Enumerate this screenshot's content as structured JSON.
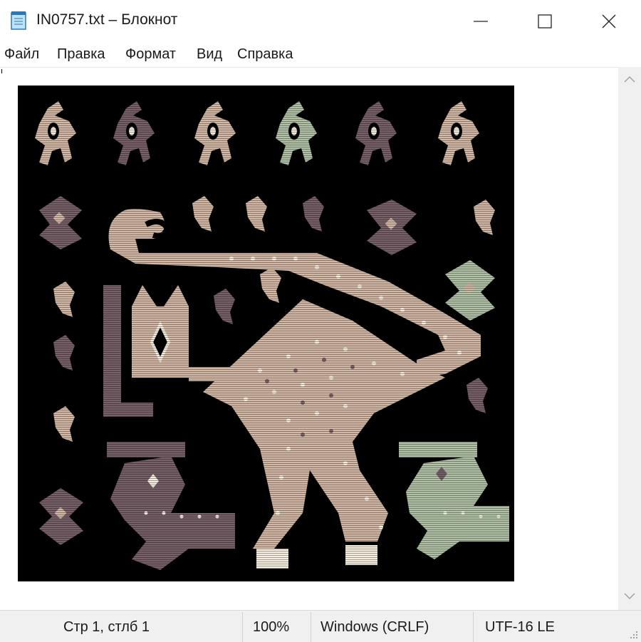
{
  "window": {
    "title": "IN0757.txt – Блокнот",
    "app_icon": "notepad-icon",
    "controls": [
      "minimize-icon",
      "maximize-icon",
      "close-icon"
    ]
  },
  "menu": [
    "Файл",
    "Правка",
    "Формат",
    "Вид",
    "Справка"
  ],
  "editor": {
    "content_image": "ascii-art-textile-figures",
    "colors": {
      "background": "#000000",
      "beige": "#d3b9a5",
      "mauve": "#776067",
      "sage": "#b0c1a6",
      "cream": "#f6efe1"
    }
  },
  "status": {
    "position": "Стр 1, стлб 1",
    "zoom": "100%",
    "line_endings": "Windows (CRLF)",
    "encoding": "UTF-16 LE"
  }
}
